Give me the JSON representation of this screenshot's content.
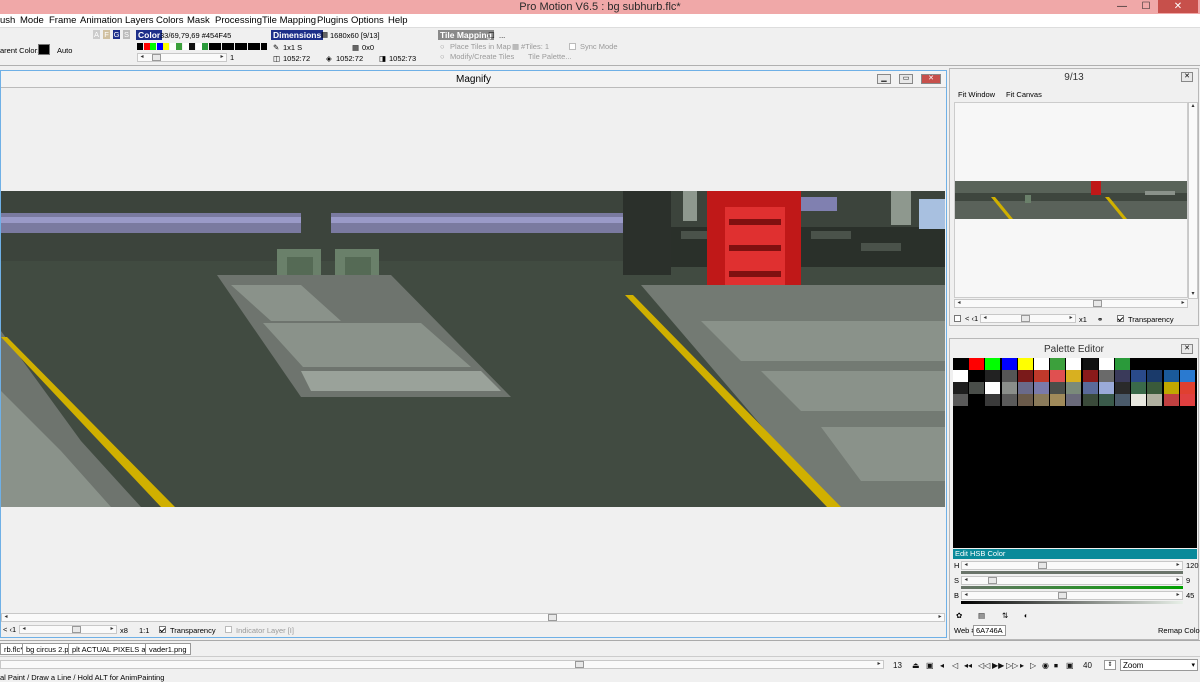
{
  "window": {
    "title": "Pro Motion V6.5 : bg subhurb.flc*",
    "minimize": "—",
    "maximize": "☐",
    "close": "✕"
  },
  "menu": [
    "ush",
    "Mode",
    "Frame",
    "Animation",
    "Layers",
    "Colors",
    "Mask",
    "Processing",
    "Tile Mapping",
    "Plugins",
    "Options",
    "Help"
  ],
  "toolbar": {
    "transparent_label": "arent Color:",
    "transparent_value": "Auto",
    "afgs": [
      "A",
      "F",
      "G",
      "S"
    ],
    "color_header": "Color",
    "color_value": "33/69,79,69 #454F45",
    "color_index": "1",
    "dimensions_header": "Dimensions",
    "dimensions_value": "1680x60 [9/13]",
    "brush_size": "1x1 S",
    "offset": "0x0",
    "coord1": "1052:72",
    "coord2": "1052:72",
    "coord3": "1052:73",
    "tile_header": "Tile Mapping",
    "tile_more": "...",
    "place_tiles": "Place Tiles in Map",
    "modify_tiles": "Modify/Create Tiles",
    "tiles_count": "#Tiles: 1",
    "tile_palette": "Tile Palette...",
    "sync_mode": "Sync Mode"
  },
  "magnify": {
    "title": "Magnify",
    "zoom_prefix": "< ‹1",
    "zoom": "x8",
    "ratio": "1:1",
    "transparency": "Transparency",
    "indicator": "Indicator Layer [I]"
  },
  "navigator": {
    "title": "9/13",
    "fit_window": "Fit Window",
    "fit_canvas": "Fit Canvas",
    "zoom_prefix": "< ‹1",
    "zoom": "x1",
    "transparency": "Transparency"
  },
  "palette": {
    "title": "Palette Editor",
    "close": "✕",
    "edit_label": "Edit HSB Color",
    "h_label": "H",
    "h_value": "120",
    "s_label": "S",
    "s_value": "9",
    "b_label": "B",
    "b_value": "45",
    "web_label": "Web #",
    "web_value": "6A746A",
    "remap_label": "Remap Color:",
    "colors": [
      [
        "#000000",
        "#ff0000",
        "#00ff00",
        "#0000ff",
        "#ffff00",
        "#ffffff",
        "#3ca03c",
        "#ffffff",
        "#111111",
        "#ffffff",
        "#2a9a3a",
        "#000000",
        "#000000",
        "#000000",
        "#000000"
      ],
      [
        "#ffffff",
        "#000000",
        "#222222",
        "#555555",
        "#7a1a1a",
        "#c0392b",
        "#e05050",
        "#d8b020",
        "#8a1a1a",
        "#6a6a6a",
        "#3a3a5a",
        "#2a4a8a",
        "#1a3a6a",
        "#1a5a9a",
        "#2a7ad0"
      ],
      [
        "#1e1e1e",
        "#4a4e4a",
        "#ffffff",
        "#8a8e8a",
        "#6a6a8a",
        "#7a7aaa",
        "#4a4e4a",
        "#7a8a7a",
        "#5a6a9a",
        "#9aaad8",
        "#2a2a2a",
        "#3a6a4a",
        "#3a5a3a",
        "#c0a800",
        "#e04030"
      ],
      [
        "#5a5a5a",
        "#000000",
        "#3a3a3a",
        "#5a5a5a",
        "#6a5a4a",
        "#8a7a5a",
        "#a08a5a",
        "#6a6a7a",
        "#3a4a3a",
        "#3a5a4a",
        "#4a5a6a",
        "#e8e8e0",
        "#b0b0a0",
        "#c04040",
        "#e04040"
      ]
    ]
  },
  "tabs": [
    "rb.flc*",
    "bg circus 2.png",
    "plt ACTUAL PIXELS a.flc",
    "vader1.png"
  ],
  "status": {
    "message": "al Paint / Draw a Line / Hold ALT for AnimPainting",
    "frame": "13",
    "fps": "40",
    "zoom_select": "Zoom",
    "playback": [
      "⏏",
      "▣",
      "◂",
      "◁",
      "◂◂",
      "◁◁",
      "▶▶",
      "▷▷",
      "▸",
      "▷",
      "◉",
      "⏹",
      "▣"
    ]
  },
  "icons": {
    "brush": "brush-icon",
    "grid": "grid-icon",
    "coord": "crosshair-icon"
  }
}
